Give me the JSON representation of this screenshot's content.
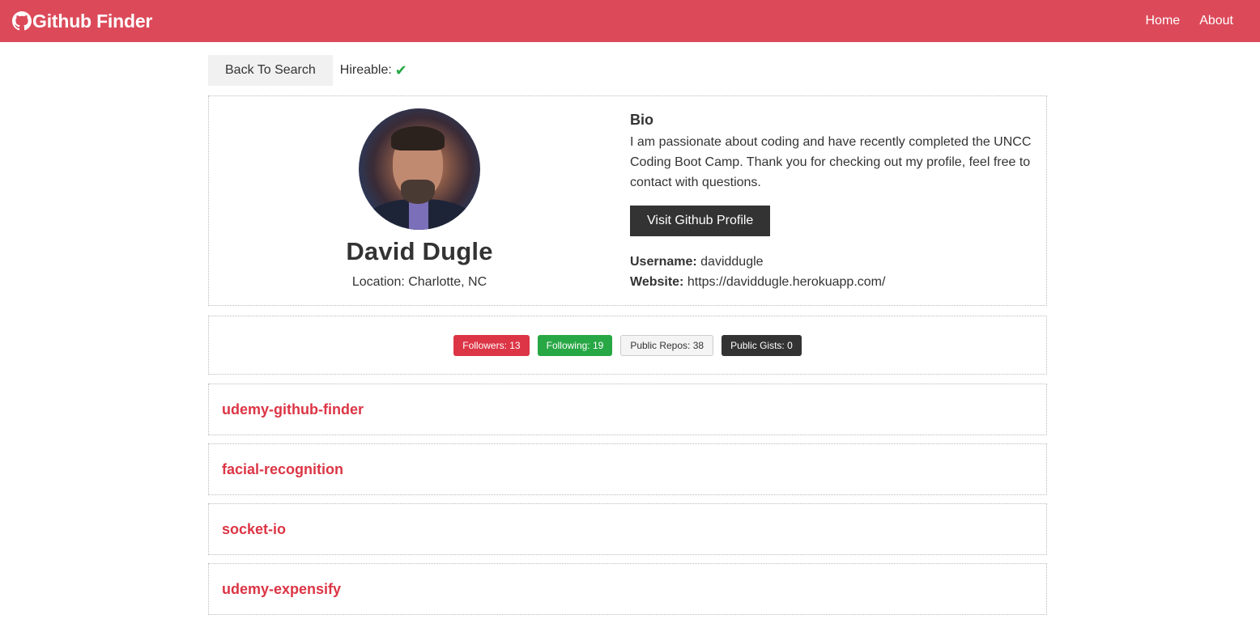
{
  "navbar": {
    "brand": "Github Finder",
    "brand_icon": "github-icon",
    "links": [
      "Home",
      "About"
    ],
    "bg_color": "#dc4a5a"
  },
  "top": {
    "back_label": "Back To Search",
    "hireable_label": "Hireable:",
    "hireable_icon": "check-icon",
    "hireable_glyph": "✔"
  },
  "profile": {
    "name": "David Dugle",
    "location": "Location: Charlotte, NC",
    "bio_title": "Bio",
    "bio": "I am passionate about coding and have recently completed the UNCC Coding Boot Camp. Thank you for checking out my profile, feel free to contact with questions.",
    "visit_label": "Visit Github Profile",
    "username_label": "Username:",
    "username": "daviddugle",
    "website_label": "Website:",
    "website": "https://daviddugle.herokuapp.com/"
  },
  "stats": {
    "followers": "Followers: 13",
    "following": "Following: 19",
    "public_repos": "Public Repos: 38",
    "public_gists": "Public Gists: 0"
  },
  "repos": [
    "udemy-github-finder",
    "facial-recognition",
    "socket-io",
    "udemy-expensify"
  ],
  "colors": {
    "danger": "#dc3545",
    "success": "#28a745",
    "dark": "#333333",
    "light": "#f4f4f4"
  }
}
